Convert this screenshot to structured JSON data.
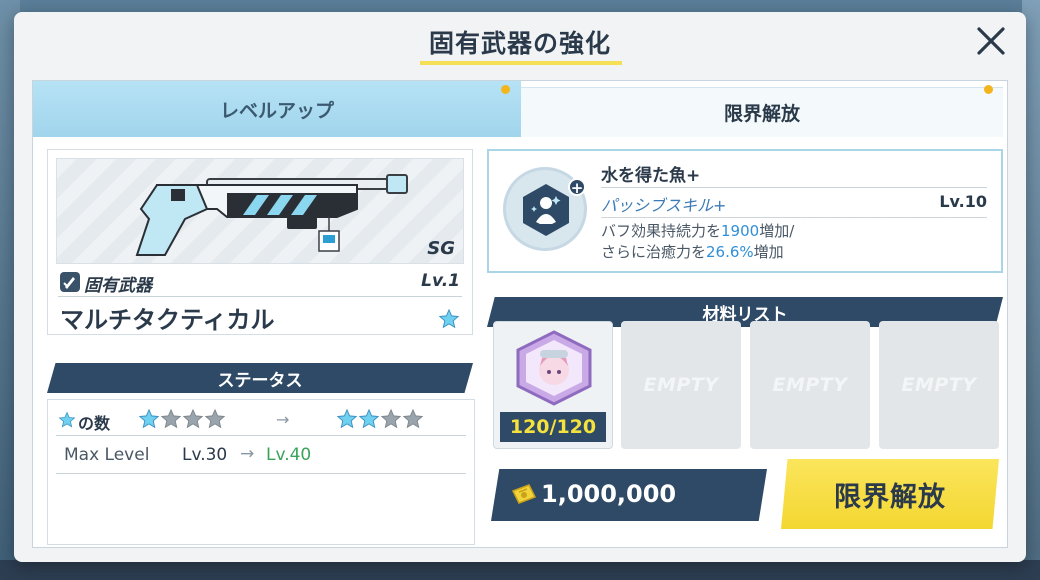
{
  "dialog": {
    "title": "固有武器の強化"
  },
  "tabs": [
    {
      "label": "レベルアップ",
      "active": false
    },
    {
      "label": "限界解放",
      "active": true
    }
  ],
  "weapon": {
    "class": "SG",
    "category": "固有武器",
    "level": "Lv.1",
    "name": "マルチタクティカル"
  },
  "status": {
    "header": "ステータス",
    "star_label": "の数",
    "stars_from": 1,
    "stars_to": 2,
    "stars_total": 4,
    "max_level_label": "Max Level",
    "max_level_from": "Lv.30",
    "max_level_to": "Lv.40"
  },
  "skill": {
    "name": "水を得た魚+",
    "type": "パッシブスキル+",
    "level": "Lv.10",
    "desc_line1_prefix": "バフ効果持続力を",
    "desc_line1_value": "1900",
    "desc_line1_suffix": "増加/",
    "desc_line2_prefix": "さらに治癒力を",
    "desc_line2_value": "26.6%",
    "desc_line2_suffix": "増加"
  },
  "materials": {
    "header": "材料リスト",
    "slots": [
      {
        "count": "120/120"
      },
      {
        "label": "EMPTY"
      },
      {
        "label": "EMPTY"
      },
      {
        "label": "EMPTY"
      }
    ]
  },
  "cost": {
    "value": "1,000,000"
  },
  "action": {
    "label": "限界解放"
  },
  "colors": {
    "accent_yellow": "#f4df56",
    "navy": "#2e4a66",
    "tab_blue": "#a1d5ec",
    "highlight_blue": "#2f8fd8",
    "level_green": "#3aa35a"
  }
}
